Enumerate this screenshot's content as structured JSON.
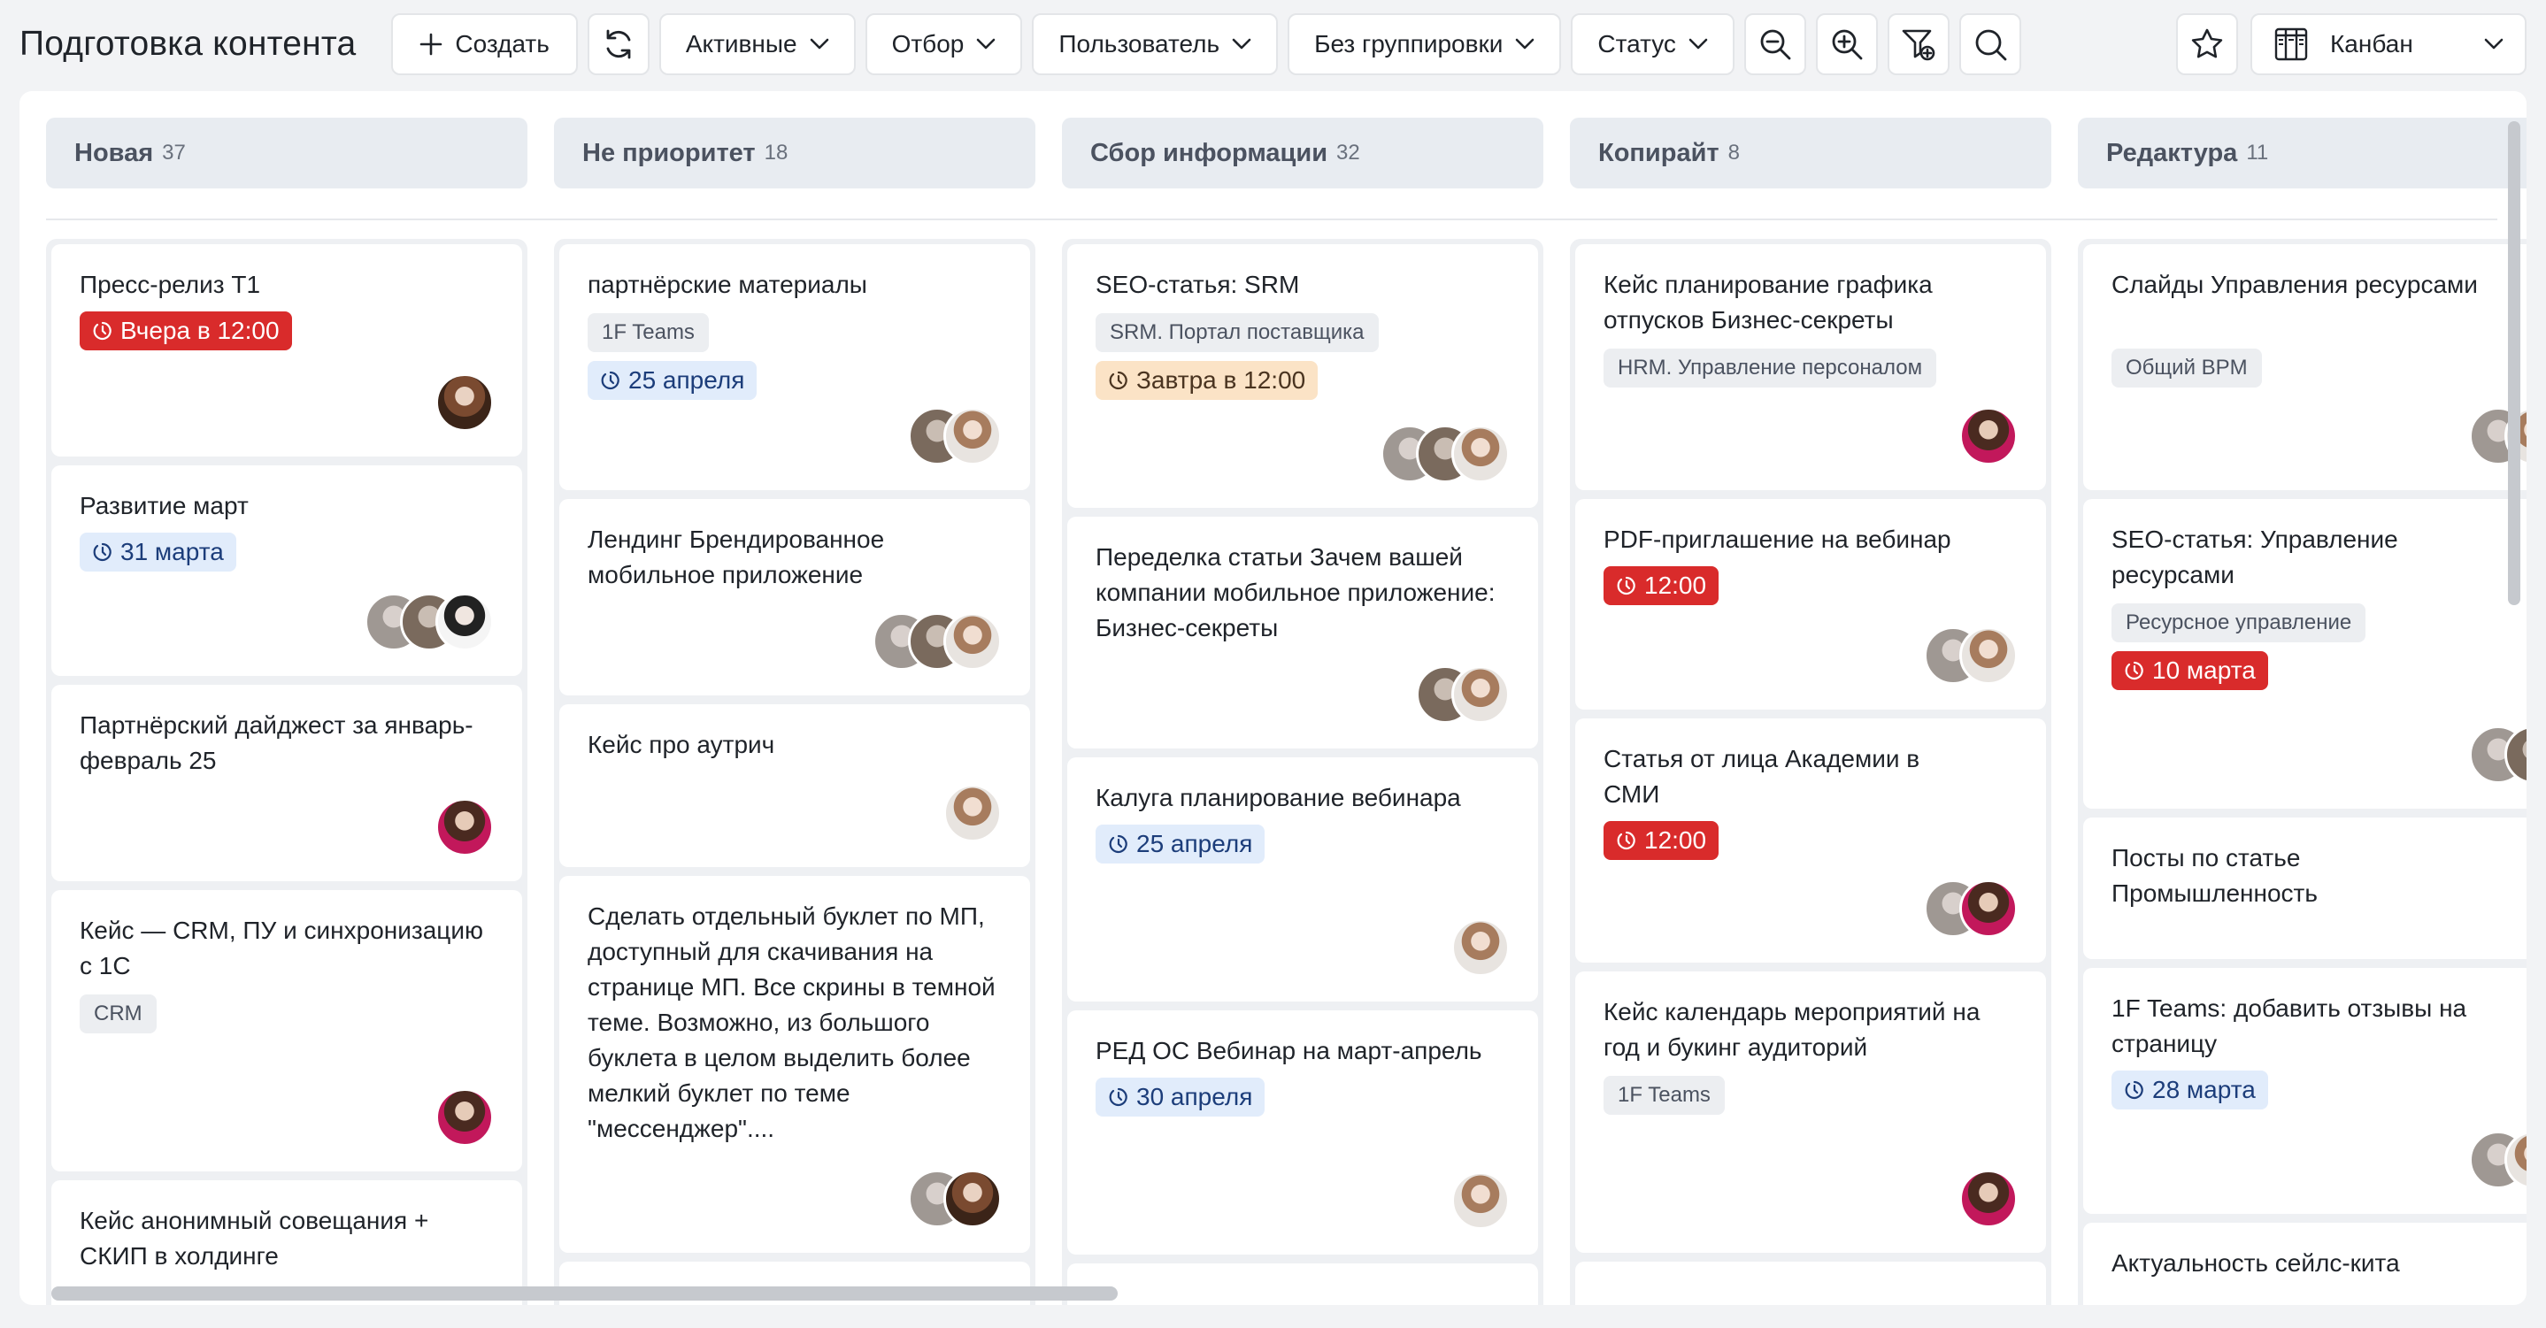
{
  "header": {
    "title": "Подготовка контента",
    "create_label": "Создать",
    "filters": [
      {
        "label": "Активные"
      },
      {
        "label": "Отбор"
      },
      {
        "label": "Пользователь"
      },
      {
        "label": "Без группировки"
      },
      {
        "label": "Статус"
      }
    ],
    "icons": [
      "refresh-icon",
      "zoom-out-icon",
      "zoom-in-icon",
      "filter-add-icon",
      "search-icon",
      "star-icon",
      "kanban-icon"
    ],
    "view_label": "Канбан"
  },
  "columns": [
    {
      "name": "Новая",
      "count": "37",
      "cards": [
        {
          "title": "Пресс-релиз Т1",
          "badge": "Вчера в 12:00"
        },
        {
          "title": "Развитие март",
          "badge": "31 марта"
        },
        {
          "title": "Партнёрский дайджест за январь-февраль 25"
        },
        {
          "title": "Кейс — CRM, ПУ и синхронизацию с 1С",
          "tag": "CRM"
        },
        {
          "title": "Кейс анонимный совещания + СКИП в холдинге"
        }
      ]
    },
    {
      "name": "Не приоритет",
      "count": "18",
      "cards": [
        {
          "title": "партнёрские материалы",
          "tag": "1F Teams",
          "badge": "25 апреля"
        },
        {
          "title": "Лендинг Брендированное мобильное приложение"
        },
        {
          "title": "Кейс про аутрич"
        },
        {
          "title": "Сделать отдельный буклет по МП, доступный для скачивания на странице МП. Все скрины в темной теме. Возможно, из большого буклета в целом выделить более мелкий буклет по теме \"мессенджер\"...."
        }
      ]
    },
    {
      "name": "Сбор информации",
      "count": "32",
      "cards": [
        {
          "title": "SEO-статья: SRM",
          "tag": "SRM. Портал поставщика",
          "badge": "Завтра в 12:00"
        },
        {
          "title": "Переделка статьи Зачем вашей компании мобильное приложение: Бизнес-секреты"
        },
        {
          "title": "Калуга планирование вебинара",
          "badge": "25 апреля"
        },
        {
          "title": "РЕД ОС Вебинар на март-апрель",
          "badge": "30 апреля"
        }
      ]
    },
    {
      "name": "Копирайт",
      "count": "8",
      "cards": [
        {
          "title": "Кейс планирование графика отпусков Бизнес-секреты",
          "tag": "HRM. Управление персоналом"
        },
        {
          "title": "PDF-приглашение на вебинар",
          "badge": "12:00"
        },
        {
          "title": "Статья от лица Академии в СМИ",
          "badge": "12:00"
        },
        {
          "title": "Кейс календарь мероприятий на год и букинг аудиторий",
          "tag": "1F Teams"
        }
      ]
    },
    {
      "name": "Редактура",
      "count": "11",
      "cards": [
        {
          "title": "Слайды Управления ресурсами",
          "tag": "Общий BPM"
        },
        {
          "title": "SEO-статья: Управление ресурсами",
          "tag": "Ресурсное управление",
          "badge": "10 марта"
        },
        {
          "title": "Посты по статье Промышленность"
        },
        {
          "title": "1F Teams: добавить отзывы на страницу",
          "badge": "28 марта"
        },
        {
          "title": "Актуальность сейлс-кита"
        }
      ]
    }
  ]
}
